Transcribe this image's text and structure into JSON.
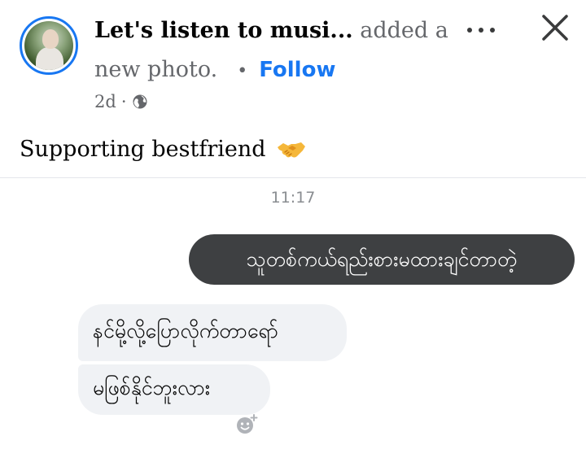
{
  "post": {
    "author": "Let's listen to musi...",
    "action_part1": "added a",
    "action_part2": "new photo.",
    "separator": "•",
    "follow_label": "Follow",
    "age": "2d",
    "meta_dot": "·",
    "privacy_icon": "globe-icon",
    "menu_icon": "more-options-icon",
    "close_icon": "close-icon",
    "caption": "Supporting bestfriend",
    "caption_emoji": "handshake-icon"
  },
  "chat": {
    "time": "11:17",
    "outgoing": [
      "သူတစ်ကယ်ရည်းစားမထားချင်တာတဲ့"
    ],
    "incoming": [
      "နင်မို့လို့ပြောလိုက်တာရော်",
      "မဖြစ်နိုင်ဘူးလား"
    ],
    "reaction_icon": "add-reaction-icon"
  },
  "colors": {
    "accent": "#1877f2",
    "outgoing_bubble": "#3e4042",
    "incoming_bubble": "#f0f2f5",
    "secondary_text": "#65676b"
  }
}
